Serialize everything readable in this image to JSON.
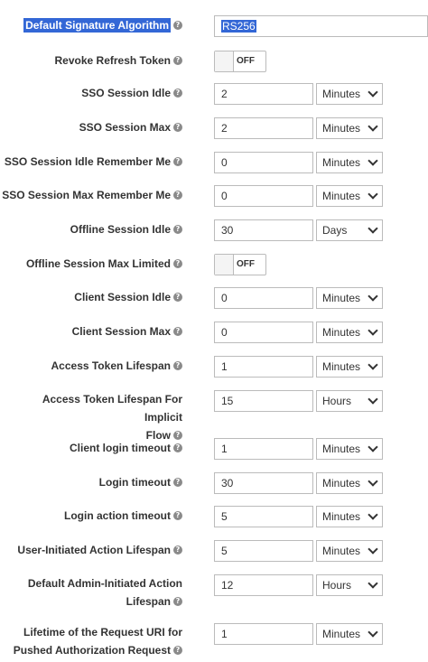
{
  "default_signature_algorithm": {
    "label": "Default Signature Algorithm",
    "value": "RS256"
  },
  "revoke_refresh_token": {
    "label": "Revoke Refresh Token",
    "state": "OFF"
  },
  "offline_session_max_limited": {
    "label": "Offline Session Max Limited",
    "state": "OFF"
  },
  "help_glyph": "?",
  "fields": [
    {
      "label": "SSO Session Idle",
      "value": "2",
      "unit": "Minutes"
    },
    {
      "label": "SSO Session Max",
      "value": "2",
      "unit": "Minutes"
    },
    {
      "label": "SSO Session Idle Remember Me",
      "value": "0",
      "unit": "Minutes"
    },
    {
      "label": "SSO Session Max Remember Me",
      "value": "0",
      "unit": "Minutes"
    },
    {
      "label": "Offline Session Idle",
      "value": "30",
      "unit": "Days"
    },
    {
      "label": "Client Session Idle",
      "value": "0",
      "unit": "Minutes"
    },
    {
      "label": "Client Session Max",
      "value": "0",
      "unit": "Minutes"
    },
    {
      "label": "Access Token Lifespan",
      "value": "1",
      "unit": "Minutes"
    },
    {
      "label_line1": "Access Token Lifespan For Implicit",
      "label_line2": "Flow",
      "value": "15",
      "unit": "Hours"
    },
    {
      "label": "Client login timeout",
      "value": "1",
      "unit": "Minutes"
    },
    {
      "label": "Login timeout",
      "value": "30",
      "unit": "Minutes"
    },
    {
      "label": "Login action timeout",
      "value": "5",
      "unit": "Minutes"
    },
    {
      "label": "User-Initiated Action Lifespan",
      "value": "5",
      "unit": "Minutes"
    },
    {
      "label_line1": "Default Admin-Initiated Action",
      "label_line2": "Lifespan",
      "value": "12",
      "unit": "Hours"
    },
    {
      "label_line1": "Lifetime of the Request URI for",
      "label_line2": "Pushed Authorization Request",
      "value": "1",
      "unit": "Minutes"
    }
  ]
}
